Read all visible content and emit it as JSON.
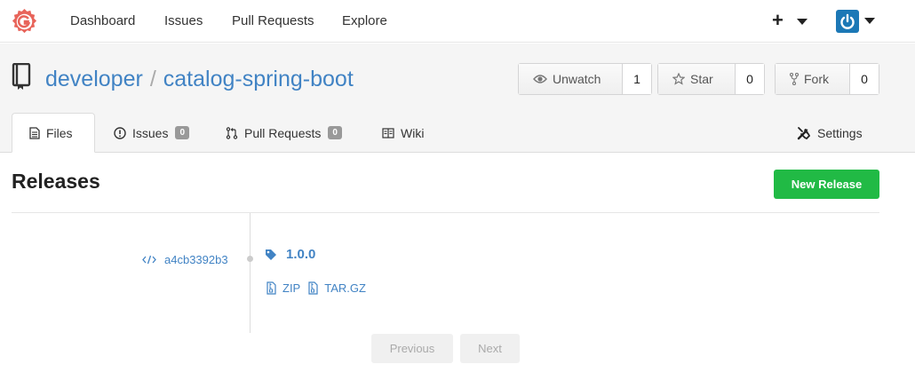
{
  "nav": {
    "items": [
      "Dashboard",
      "Issues",
      "Pull Requests",
      "Explore"
    ],
    "plus": "+"
  },
  "repo": {
    "owner": "developer",
    "separator": "/",
    "name": "catalog-spring-boot",
    "unwatch_label": "Unwatch",
    "watch_count": "1",
    "star_label": "Star",
    "star_count": "0",
    "fork_label": "Fork",
    "fork_count": "0"
  },
  "tabs": {
    "files": "Files",
    "issues": "Issues",
    "issues_count": "0",
    "pulls": "Pull Requests",
    "pulls_count": "0",
    "wiki": "Wiki",
    "settings": "Settings"
  },
  "releases": {
    "title": "Releases",
    "new_button": "New Release",
    "items": [
      {
        "commit": "a4cb3392b3",
        "tag": "1.0.0",
        "downloads": [
          "ZIP",
          "TAR.GZ"
        ]
      }
    ]
  },
  "pagination": {
    "previous": "Previous",
    "next": "Next"
  },
  "colors": {
    "link": "#4183c4",
    "primary_green": "#21ba45",
    "logo_red": "#d9534f",
    "avatar_blue": "#1c78b6"
  }
}
